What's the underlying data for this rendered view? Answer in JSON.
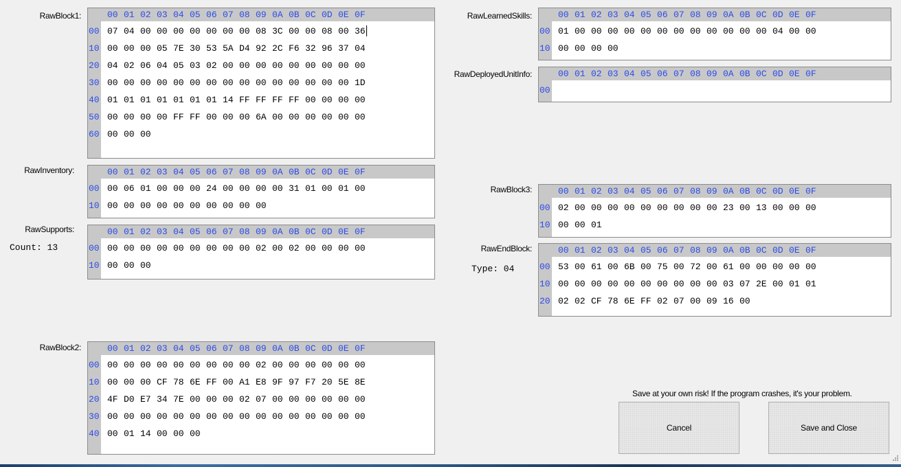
{
  "header_cols": [
    "00",
    "01",
    "02",
    "03",
    "04",
    "05",
    "06",
    "07",
    "08",
    "09",
    "0A",
    "0B",
    "0C",
    "0D",
    "0E",
    "0F"
  ],
  "blocks": {
    "rawblock1": {
      "label": "RawBlock1:",
      "rows": [
        {
          "offset": "00",
          "bytes": [
            "07",
            "04",
            "00",
            "00",
            "00",
            "00",
            "00",
            "00",
            "00",
            "08",
            "3C",
            "00",
            "00",
            "08",
            "00",
            "36"
          ]
        },
        {
          "offset": "10",
          "bytes": [
            "00",
            "00",
            "00",
            "05",
            "7E",
            "30",
            "53",
            "5A",
            "D4",
            "92",
            "2C",
            "F6",
            "32",
            "96",
            "37",
            "04"
          ]
        },
        {
          "offset": "20",
          "bytes": [
            "04",
            "02",
            "06",
            "04",
            "05",
            "03",
            "02",
            "00",
            "00",
            "00",
            "00",
            "00",
            "00",
            "00",
            "00",
            "00"
          ]
        },
        {
          "offset": "30",
          "bytes": [
            "00",
            "00",
            "00",
            "00",
            "00",
            "00",
            "00",
            "00",
            "00",
            "00",
            "00",
            "00",
            "00",
            "00",
            "00",
            "1D"
          ]
        },
        {
          "offset": "40",
          "bytes": [
            "01",
            "01",
            "01",
            "01",
            "01",
            "01",
            "01",
            "14",
            "FF",
            "FF",
            "FF",
            "FF",
            "00",
            "00",
            "00",
            "00"
          ]
        },
        {
          "offset": "50",
          "bytes": [
            "00",
            "00",
            "00",
            "00",
            "FF",
            "FF",
            "00",
            "00",
            "00",
            "6A",
            "00",
            "00",
            "00",
            "00",
            "00",
            "00"
          ]
        },
        {
          "offset": "60",
          "bytes": [
            "00",
            "00",
            "00"
          ]
        }
      ]
    },
    "rawinventory": {
      "label": "RawInventory:",
      "rows": [
        {
          "offset": "00",
          "bytes": [
            "00",
            "06",
            "01",
            "00",
            "00",
            "00",
            "24",
            "00",
            "00",
            "00",
            "00",
            "31",
            "01",
            "00",
            "01",
            "00"
          ]
        },
        {
          "offset": "10",
          "bytes": [
            "00",
            "00",
            "00",
            "00",
            "00",
            "00",
            "00",
            "00",
            "00",
            "00"
          ]
        }
      ]
    },
    "rawsupports": {
      "label": "RawSupports:",
      "sub": "Count: 13",
      "rows": [
        {
          "offset": "00",
          "bytes": [
            "00",
            "00",
            "00",
            "00",
            "00",
            "00",
            "00",
            "00",
            "00",
            "02",
            "00",
            "02",
            "00",
            "00",
            "00",
            "00"
          ]
        },
        {
          "offset": "10",
          "bytes": [
            "00",
            "00",
            "00"
          ]
        }
      ]
    },
    "rawblock2": {
      "label": "RawBlock2:",
      "rows": [
        {
          "offset": "00",
          "bytes": [
            "00",
            "00",
            "00",
            "00",
            "00",
            "00",
            "00",
            "00",
            "00",
            "02",
            "00",
            "00",
            "00",
            "00",
            "00",
            "00"
          ]
        },
        {
          "offset": "10",
          "bytes": [
            "00",
            "00",
            "00",
            "CF",
            "78",
            "6E",
            "FF",
            "00",
            "A1",
            "E8",
            "9F",
            "97",
            "F7",
            "20",
            "5E",
            "8E"
          ]
        },
        {
          "offset": "20",
          "bytes": [
            "4F",
            "D0",
            "E7",
            "34",
            "7E",
            "00",
            "00",
            "00",
            "02",
            "07",
            "00",
            "00",
            "00",
            "00",
            "00",
            "00"
          ]
        },
        {
          "offset": "30",
          "bytes": [
            "00",
            "00",
            "00",
            "00",
            "00",
            "00",
            "00",
            "00",
            "00",
            "00",
            "00",
            "00",
            "00",
            "00",
            "00",
            "00"
          ]
        },
        {
          "offset": "40",
          "bytes": [
            "00",
            "01",
            "14",
            "00",
            "00",
            "00"
          ]
        }
      ]
    },
    "rawlearnedskills": {
      "label": "RawLearnedSkills:",
      "rows": [
        {
          "offset": "00",
          "bytes": [
            "01",
            "00",
            "00",
            "00",
            "00",
            "00",
            "00",
            "00",
            "00",
            "00",
            "00",
            "00",
            "00",
            "04",
            "00",
            "00"
          ]
        },
        {
          "offset": "10",
          "bytes": [
            "00",
            "00",
            "00",
            "00"
          ]
        }
      ]
    },
    "rawdeployedunitinfo": {
      "label": "RawDeployedUnitInfo:",
      "rows": [
        {
          "offset": "00",
          "bytes": []
        }
      ]
    },
    "rawblock3": {
      "label": "RawBlock3:",
      "rows": [
        {
          "offset": "00",
          "bytes": [
            "02",
            "00",
            "00",
            "00",
            "00",
            "00",
            "00",
            "00",
            "00",
            "00",
            "23",
            "00",
            "13",
            "00",
            "00",
            "00"
          ]
        },
        {
          "offset": "10",
          "bytes": [
            "00",
            "00",
            "01"
          ]
        }
      ]
    },
    "rawendblock": {
      "label": "RawEndBlock:",
      "sub": "Type: 04",
      "rows": [
        {
          "offset": "00",
          "bytes": [
            "53",
            "00",
            "61",
            "00",
            "6B",
            "00",
            "75",
            "00",
            "72",
            "00",
            "61",
            "00",
            "00",
            "00",
            "00",
            "00"
          ]
        },
        {
          "offset": "10",
          "bytes": [
            "00",
            "00",
            "00",
            "00",
            "00",
            "00",
            "00",
            "00",
            "00",
            "00",
            "03",
            "07",
            "2E",
            "00",
            "01",
            "01"
          ]
        },
        {
          "offset": "20",
          "bytes": [
            "02",
            "02",
            "CF",
            "78",
            "6E",
            "FF",
            "02",
            "07",
            "00",
            "09",
            "16",
            "00"
          ]
        }
      ]
    }
  },
  "warning": "Save at your own risk! If the program crashes, it's your problem.",
  "buttons": {
    "cancel": "Cancel",
    "save_close": "Save and Close"
  },
  "colors": {
    "offset_blue": "#2b4be8",
    "gutter_gray": "#c8c8c8"
  }
}
